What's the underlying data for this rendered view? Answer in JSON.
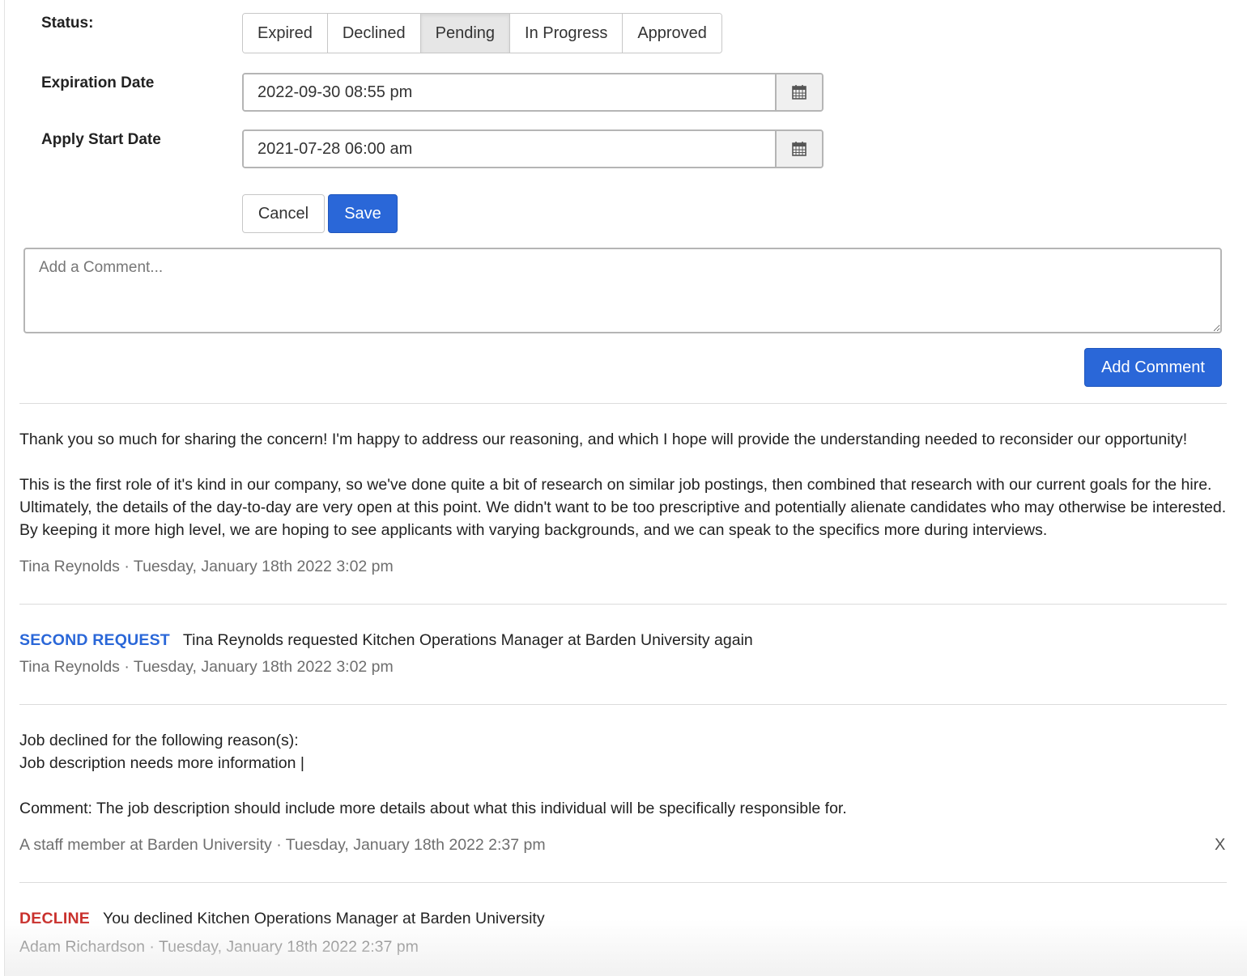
{
  "form": {
    "status_label": "Status:",
    "status_options": [
      "Expired",
      "Declined",
      "Pending",
      "In Progress",
      "Approved"
    ],
    "status_selected": "Pending",
    "expiration_label": "Expiration Date",
    "expiration_value": "2022-09-30 08:55 pm",
    "apply_start_label": "Apply Start Date",
    "apply_start_value": "2021-07-28 06:00 am",
    "calendar_icon": "calendar-icon",
    "cancel_label": "Cancel",
    "save_label": "Save"
  },
  "comment": {
    "placeholder": "Add a Comment...",
    "add_label": "Add Comment"
  },
  "feed": {
    "entry1": {
      "paragraph1": "Thank you so much for sharing the concern! I'm happy to address our reasoning, and which I hope will provide the understanding needed to reconsider our opportunity!",
      "paragraph2": "This is the first role of it's kind in our company, so we've done quite a bit of research on similar job postings, then combined that research with our current goals for the hire. Ultimately, the details of the day-to-day are very open at this point. We didn't want to be too prescriptive and potentially alienate candidates who may otherwise be interested. By keeping it more high level, we are hoping to see applicants with varying backgrounds, and we can speak to the specifics more during interviews.",
      "meta": "Tina Reynolds · Tuesday, January 18th 2022 3:02 pm"
    },
    "entry2": {
      "tag": "SECOND REQUEST",
      "text": "Tina Reynolds requested Kitchen Operations Manager at Barden University again",
      "meta": "Tina Reynolds · Tuesday, January 18th 2022 3:02 pm"
    },
    "entry3": {
      "line1": "Job declined for the following reason(s):",
      "line2": "Job description needs more information |",
      "comment": "Comment: The job description should include more details about what this individual will be specifically responsible for.",
      "meta": "A staff member at Barden University · Tuesday, January 18th 2022 2:37 pm",
      "close": "X"
    },
    "entry4": {
      "tag": "DECLINE",
      "text": "You declined Kitchen Operations Manager at Barden University",
      "meta": "Adam Richardson · Tuesday, January 18th 2022 2:37 pm"
    }
  },
  "colors": {
    "primary": "#2a67d8",
    "decline": "#c9302c",
    "meta_text": "#6e6e6e"
  }
}
